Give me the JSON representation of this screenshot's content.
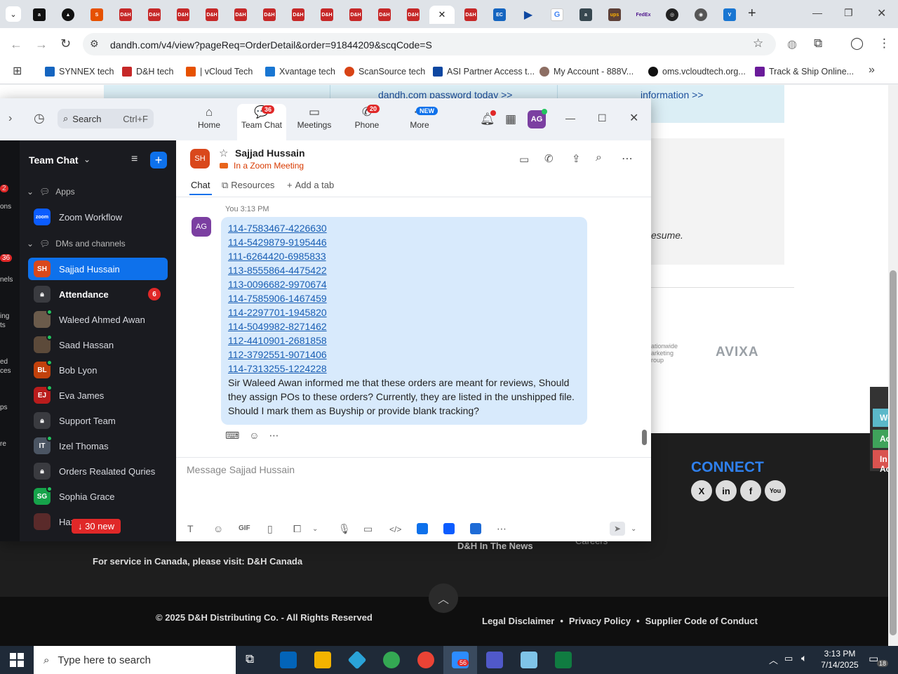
{
  "browser": {
    "url": "dandh.com/v4/view?pageReq=OrderDetail&order=91844209&scqCode=S",
    "active_tab_close": "✕",
    "new_tab": "+",
    "bookmarks": [
      {
        "label": "SYNNEX tech",
        "color": "#1565c0"
      },
      {
        "label": "D&H tech",
        "color": "#c62828"
      },
      {
        "label": "| vCloud Tech",
        "color": "#e65100"
      },
      {
        "label": "Xvantage tech",
        "color": "#1976d2"
      },
      {
        "label": "ScanSource tech",
        "color": "#d84315"
      },
      {
        "label": "ASI Partner Access t...",
        "color": "#0d47a1"
      },
      {
        "label": "My Account - 888V...",
        "color": "#8d6e63"
      },
      {
        "label": "oms.vcloudtech.org...",
        "color": "#111111"
      },
      {
        "label": "Track & Ship Online...",
        "color": "#6a1b9a"
      }
    ]
  },
  "page": {
    "top_links": [
      "dandh.com password today >>",
      "information >>"
    ],
    "italic_text": "esume.",
    "brands": [
      "ationwide arketing roup",
      "AVIXA"
    ],
    "connect": "CONNECT",
    "side_tabs": [
      "Worl",
      "Activ",
      "In Ac"
    ],
    "footer_canada": "For service in Canada, please visit: D&H Canada",
    "footer_news": "D&H In The News",
    "footer_careers": "Careers",
    "copyright": "© 2025 D&H Distributing Co. - All Rights Reserved",
    "legal": "Legal Disclaimer",
    "privacy": "Privacy Policy",
    "supplier": "Supplier Code of Conduct",
    "bullet": "•"
  },
  "zoom": {
    "search_label": "Search",
    "search_shortcut": "Ctrl+F",
    "nav": [
      {
        "label": "Home",
        "icon": "⌂",
        "badge": ""
      },
      {
        "label": "Team Chat",
        "icon": "💬",
        "badge": "36"
      },
      {
        "label": "Meetings",
        "icon": "▭",
        "badge": ""
      },
      {
        "label": "Phone",
        "icon": "✆",
        "badge": "20"
      },
      {
        "label": "More",
        "icon": "⋯",
        "badge": "NEW"
      }
    ],
    "user_initials": "AG",
    "sidebar_title": "Team Chat",
    "section_apps": "Apps",
    "section_dms": "DMs and channels",
    "left_strip_labels": [
      "ons",
      "36",
      "nels",
      "ing",
      "ts",
      "ed",
      "ces",
      "ps",
      "re",
      "2"
    ],
    "items": [
      {
        "name": "Zoom Workflow",
        "initials": "zoom",
        "color": "#0b5cff",
        "bold": false,
        "badge": "",
        "locked": false
      },
      {
        "name": "Sajjad Hussain",
        "initials": "SH",
        "color": "#d9481c",
        "bold": false,
        "badge": "",
        "locked": false
      },
      {
        "name": "Attendance",
        "initials": "",
        "color": "#3a3b40",
        "bold": true,
        "badge": "6",
        "locked": true
      },
      {
        "name": "Waleed Ahmed Awan",
        "initials": "",
        "color": "#6b5b4b",
        "bold": false,
        "badge": "",
        "locked": false
      },
      {
        "name": "Saad Hassan",
        "initials": "",
        "color": "#5c4a3a",
        "bold": false,
        "badge": "",
        "locked": false
      },
      {
        "name": "Bob Lyon",
        "initials": "BL",
        "color": "#c2410c",
        "bold": false,
        "badge": "",
        "locked": false
      },
      {
        "name": "Eva James",
        "initials": "EJ",
        "color": "#b91c1c",
        "bold": false,
        "badge": "",
        "locked": false
      },
      {
        "name": "Support Team",
        "initials": "",
        "color": "#3a3b40",
        "bold": false,
        "badge": "",
        "locked": true
      },
      {
        "name": "Izel Thomas",
        "initials": "IT",
        "color": "#4b5563",
        "bold": false,
        "badge": "",
        "locked": false
      },
      {
        "name": "Orders Realated Quries",
        "initials": "",
        "color": "#3a3b40",
        "bold": false,
        "badge": "",
        "locked": true
      },
      {
        "name": "Sophia Grace",
        "initials": "SG",
        "color": "#16a34a",
        "bold": false,
        "badge": "",
        "locked": false
      },
      {
        "name": "Haz",
        "initials": "",
        "color": "#5a2a2a",
        "bold": false,
        "badge": "",
        "locked": false
      }
    ],
    "new_messages": "↓ 30 new",
    "chat": {
      "contact_initials": "SH",
      "contact_name": "Sajjad Hussain",
      "status": "In a Zoom Meeting",
      "tabs": [
        "Chat",
        "Resources",
        "Add a tab"
      ],
      "sender": "You 3:13 PM",
      "avatar": "AG",
      "orders": [
        "114-7583467-4226630",
        "114-5429879-9195446",
        "111-6264420-6985833",
        "113-8555864-4475422",
        "113-0096682-9970674",
        "114-7585906-1467459",
        "114-2297701-1945820",
        "114-5049982-8271462",
        "112-4410901-2681858",
        "112-3792551-9071406",
        "114-7313255-1224228"
      ],
      "message_text": "Sir Waleed Awan informed me that these orders are meant for reviews, Should they assign POs to these orders? Currently, they are listed in the unshipped file. Should I mark them as Buyship or provide blank tracking?",
      "compose_placeholder": "Message Sajjad Hussain"
    }
  },
  "taskbar": {
    "search_placeholder": "Type here to search",
    "zoom_badge": "56",
    "time": "3:13 PM",
    "date": "7/14/2025",
    "notifications": "18"
  }
}
